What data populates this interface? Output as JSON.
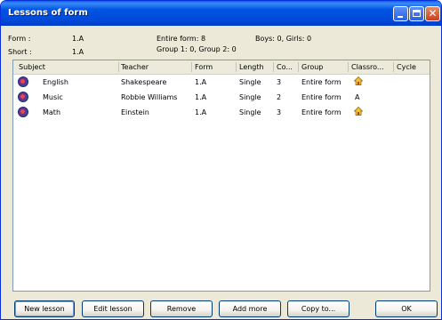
{
  "window": {
    "title": "Lessons of form"
  },
  "info": {
    "form_label": "Form :",
    "form_value": "1.A",
    "short_label": "Short :",
    "short_value": "1.A",
    "entire_form": "Entire form: 8",
    "groups": "Group 1: 0, Group 2: 0",
    "boys_girls": "Boys: 0, Girls: 0"
  },
  "columns": [
    "Subject",
    "Teacher",
    "Form",
    "Length",
    "Co...",
    "Group",
    "Classro...",
    "Cycle"
  ],
  "rows": [
    {
      "subject": "English",
      "teacher": "Shakespeare",
      "form": "1.A",
      "length": "Single",
      "count": "3",
      "group": "Entire form",
      "classroom": "",
      "classroom_icon": "house-icon",
      "cycle": ""
    },
    {
      "subject": "Music",
      "teacher": "Robbie Williams",
      "form": "1.A",
      "length": "Single",
      "count": "2",
      "group": "Entire form",
      "classroom": "A",
      "classroom_icon": "",
      "cycle": ""
    },
    {
      "subject": "Math",
      "teacher": "Einstein",
      "form": "1.A",
      "length": "Single",
      "count": "3",
      "group": "Entire form",
      "classroom": "",
      "classroom_icon": "house-icon",
      "cycle": ""
    }
  ],
  "buttons": {
    "new_lesson": "New lesson",
    "edit_lesson": "Edit lesson",
    "remove": "Remove",
    "add_more": "Add more",
    "copy_to": "Copy to...",
    "ok": "OK"
  },
  "colors": {
    "titlebar": "#0054e3",
    "window_bg": "#ece9d8",
    "list_border": "#7f9db9"
  }
}
